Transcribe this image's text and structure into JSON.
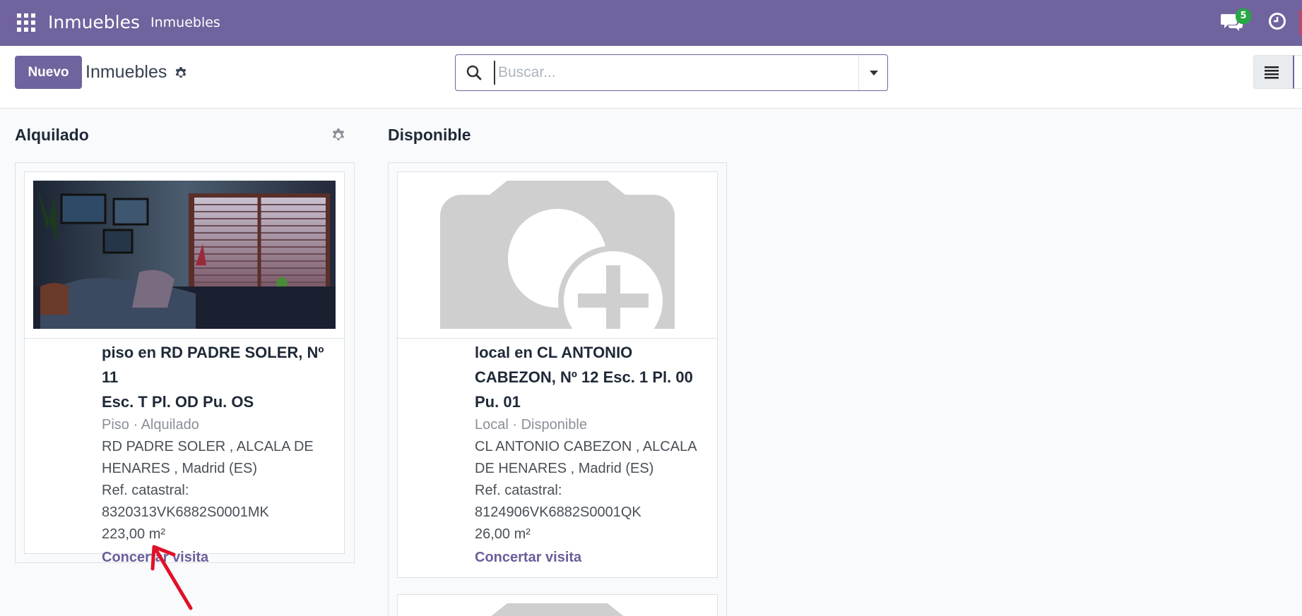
{
  "navbar": {
    "app_name": "Inmuebles",
    "menu_item": "Inmuebles",
    "chat_count": "5",
    "brand_color": "#71639e"
  },
  "control_panel": {
    "new_button": "Nuevo",
    "breadcrumb": "Inmuebles",
    "search_placeholder": "Buscar..."
  },
  "columns": [
    {
      "title": "Alquilado",
      "cards": [
        {
          "title_line1": "piso en RD PADRE SOLER, Nº 11",
          "title_line2": "Esc. T Pl. OD Pu. OS",
          "subtitle": "Piso · Alquilado",
          "address_line1": "RD PADRE SOLER , ALCALA DE",
          "address_line2": "HENARES , Madrid (ES)",
          "ref_label": "Ref. catastral:",
          "ref_value": "8320313VK6882S0001MK",
          "area": "223,00 m²",
          "link": "Concertar visita",
          "image": "living-room-photo"
        }
      ]
    },
    {
      "title": "Disponible",
      "cards": [
        {
          "title_line1": "local en CL ANTONIO",
          "title_line2": "CABEZON, Nº 12 Esc. 1 Pl. 00",
          "title_line3": "Pu. 01",
          "subtitle": "Local · Disponible",
          "address_line1": "CL ANTONIO CABEZON , ALCALA",
          "address_line2": "DE HENARES , Madrid (ES)",
          "ref_label": "Ref. catastral:",
          "ref_value": "8124906VK6882S0001QK",
          "area": "26,00 m²",
          "link": "Concertar visita",
          "image": "camera-placeholder-icon"
        }
      ]
    }
  ]
}
